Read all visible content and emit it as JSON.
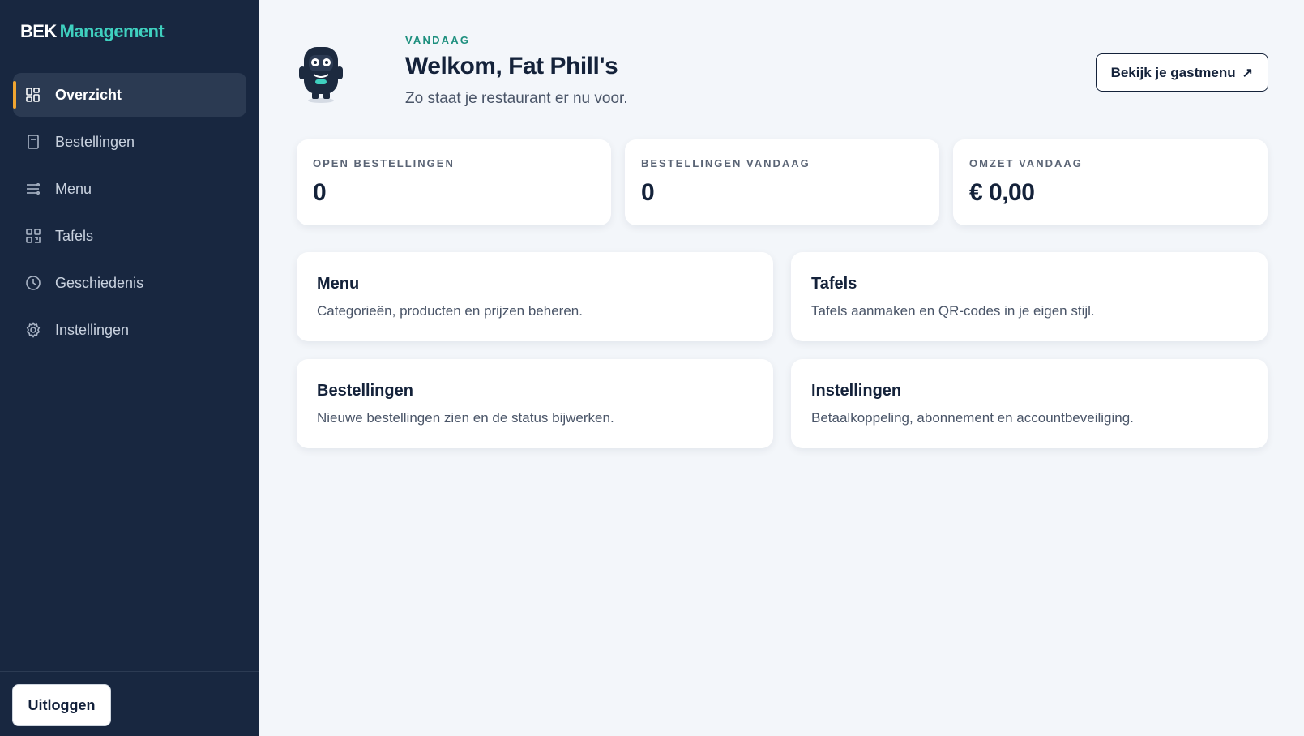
{
  "brand": {
    "part1": "BEK",
    "part2": "Management",
    "accent": "#3fd0bf"
  },
  "sidebar": {
    "items": [
      {
        "label": "Overzicht",
        "icon": "grid-dashboard-icon",
        "active": true
      },
      {
        "label": "Bestellingen",
        "icon": "receipt-icon"
      },
      {
        "label": "Menu",
        "icon": "menu-list-icon"
      },
      {
        "label": "Tafels",
        "icon": "tables-grid-icon"
      },
      {
        "label": "Geschiedenis",
        "icon": "clock-icon"
      },
      {
        "label": "Instellingen",
        "icon": "gear-icon"
      }
    ],
    "logout_label": "Uitloggen",
    "active_indicator_color": "#f0a531"
  },
  "header": {
    "eyebrow": "VANDAAG",
    "title": "Welkom, Fat Phill's",
    "subtitle": "Zo staat je restaurant er nu voor.",
    "guest_menu_label": "Bekijk je gastmenu",
    "guest_menu_icon": "external-arrow-icon"
  },
  "stats": [
    {
      "label": "OPEN BESTELLINGEN",
      "value": "0"
    },
    {
      "label": "BESTELLINGEN VANDAAG",
      "value": "0"
    },
    {
      "label": "OMZET VANDAAG",
      "value": "€ 0,00"
    }
  ],
  "cards": [
    {
      "title": "Menu",
      "description": "Categorieën, producten en prijzen beheren."
    },
    {
      "title": "Tafels",
      "description": "Tafels aanmaken en QR-codes in je eigen stijl."
    },
    {
      "title": "Bestellingen",
      "description": "Nieuwe bestellingen zien en de status bijwerken."
    },
    {
      "title": "Instellingen",
      "description": "Betaalkoppeling, abonnement en accountbeveiliging."
    }
  ]
}
